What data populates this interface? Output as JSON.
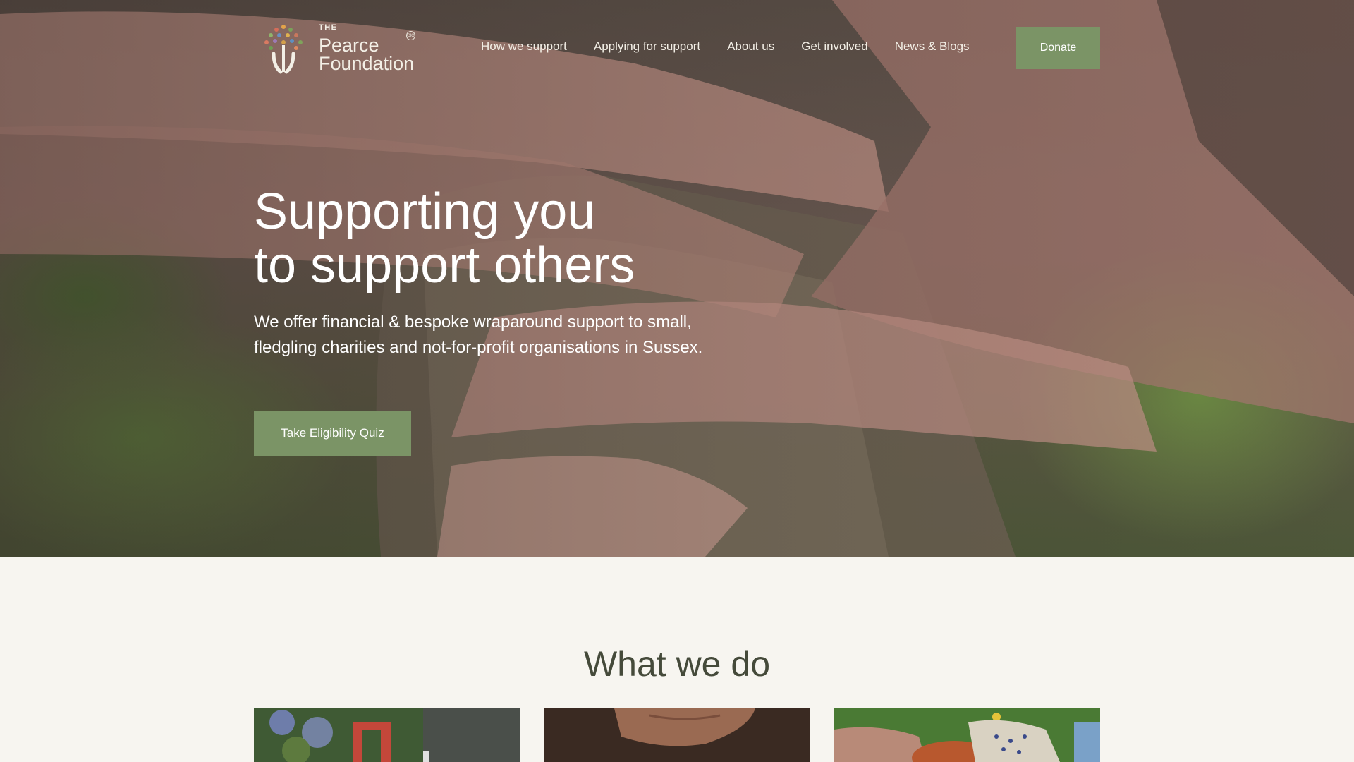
{
  "brand": {
    "the": "THE",
    "name_line1": "Pearce",
    "name_line2": "Foundation",
    "badge": "CIO"
  },
  "nav": {
    "items": [
      {
        "label": "How we support"
      },
      {
        "label": "Applying for support"
      },
      {
        "label": "About us"
      },
      {
        "label": "Get involved"
      },
      {
        "label": "News & Blogs"
      }
    ],
    "donate_label": "Donate"
  },
  "hero": {
    "title_line1": "Supporting you",
    "title_line2": "to support others",
    "subtitle": "We offer financial & bespoke wraparound support to small, fledgling charities and not-for-profit organisations in Sussex.",
    "cta_label": "Take Eligibility Quiz"
  },
  "what_we_do": {
    "title": "What we do"
  },
  "colors": {
    "accent": "#7b9466",
    "background": "#f7f5f0",
    "heading": "#454a3a"
  }
}
